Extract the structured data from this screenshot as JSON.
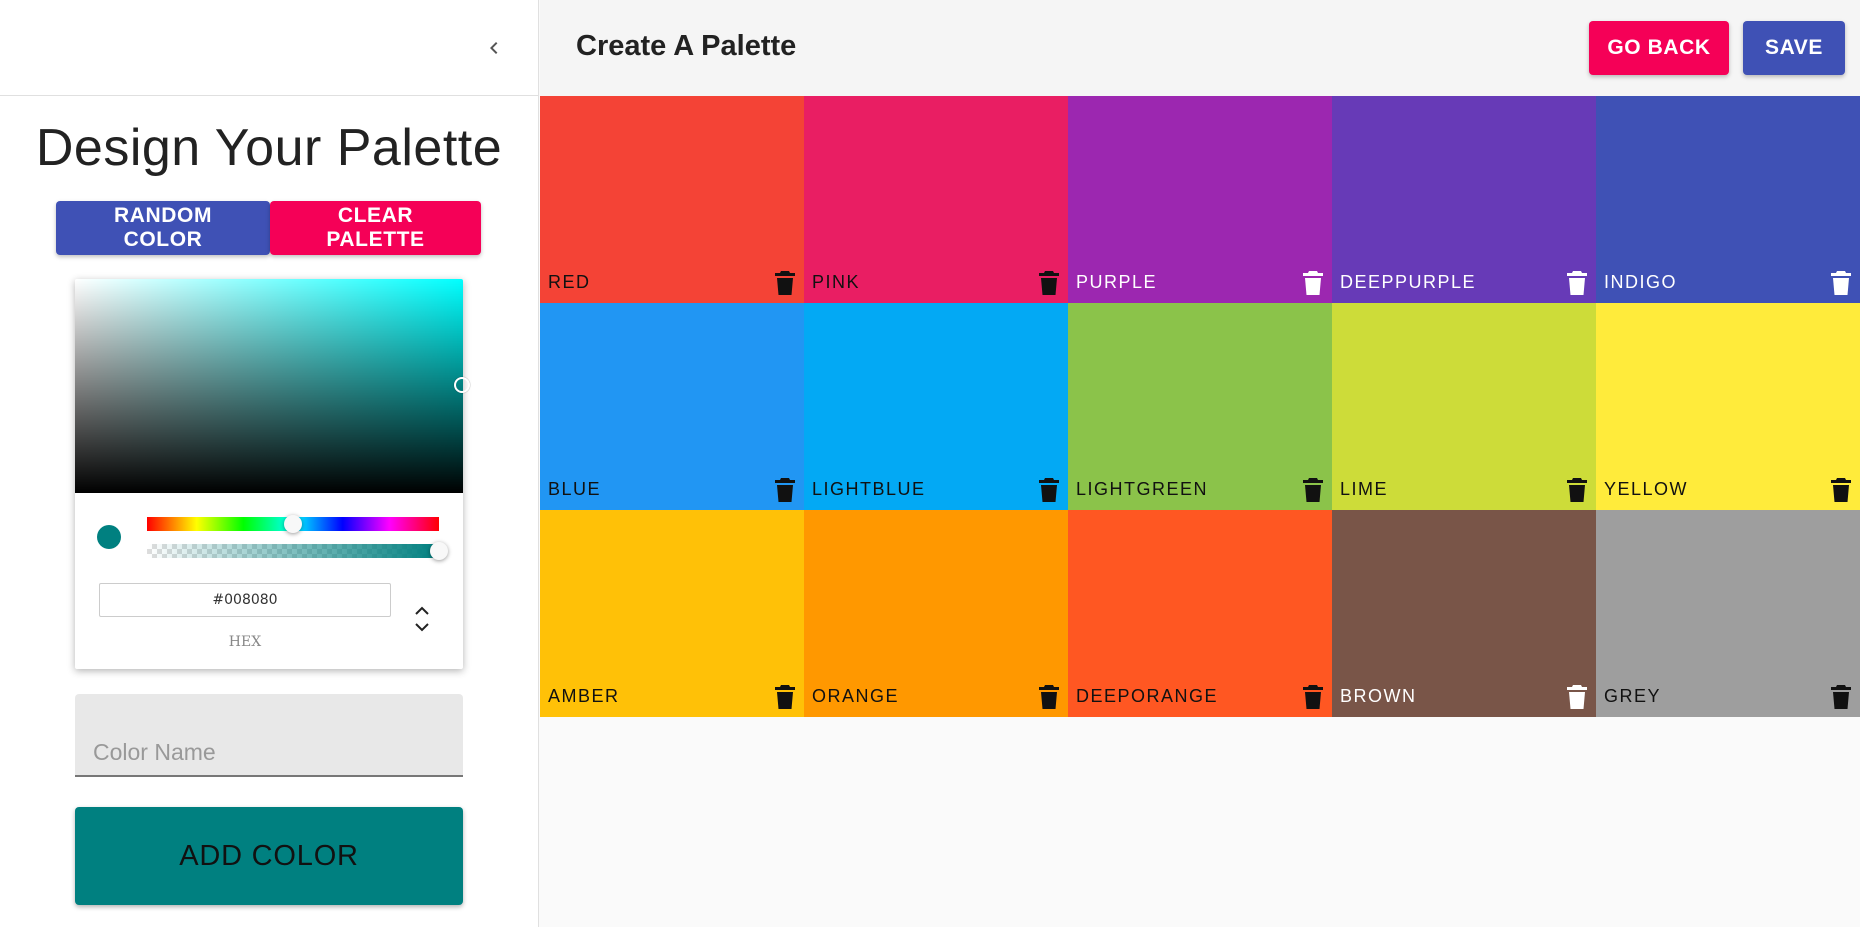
{
  "drawer": {
    "collapse_icon": "chevron-left-icon",
    "title": "Design Your Palette",
    "random_label": "RANDOM COLOR",
    "clear_label": "CLEAR PALETTE",
    "accent_random": "#3f51b5",
    "accent_clear": "#f50057"
  },
  "picker": {
    "hex_value": "#008080",
    "mode_label": "HEX",
    "current_color": "#008080",
    "hue_fraction": 0.5,
    "alpha_fraction": 1.0
  },
  "name_field": {
    "placeholder": "Color Name"
  },
  "add_button": {
    "label": "ADD COLOR",
    "color": "#008080"
  },
  "appbar": {
    "title": "Create A Palette",
    "back_label": "GO BACK",
    "save_label": "SAVE"
  },
  "palette": [
    {
      "name": "red",
      "color": "#f44336",
      "dark_text": true
    },
    {
      "name": "pink",
      "color": "#e91e63",
      "dark_text": true
    },
    {
      "name": "purple",
      "color": "#9c27b0",
      "dark_text": false
    },
    {
      "name": "deeppurple",
      "color": "#673ab7",
      "dark_text": false
    },
    {
      "name": "indigo",
      "color": "#3f51b5",
      "dark_text": false
    },
    {
      "name": "blue",
      "color": "#2196f3",
      "dark_text": true
    },
    {
      "name": "lightblue",
      "color": "#03a9f4",
      "dark_text": true
    },
    {
      "name": "lightgreen",
      "color": "#8bc34a",
      "dark_text": true
    },
    {
      "name": "lime",
      "color": "#cddc39",
      "dark_text": true
    },
    {
      "name": "yellow",
      "color": "#ffeb3b",
      "dark_text": true
    },
    {
      "name": "amber",
      "color": "#ffc107",
      "dark_text": true
    },
    {
      "name": "orange",
      "color": "#ff9800",
      "dark_text": true
    },
    {
      "name": "deeporange",
      "color": "#ff5722",
      "dark_text": true
    },
    {
      "name": "brown",
      "color": "#795548",
      "dark_text": false
    },
    {
      "name": "grey",
      "color": "#9e9e9e",
      "dark_text": true
    }
  ]
}
